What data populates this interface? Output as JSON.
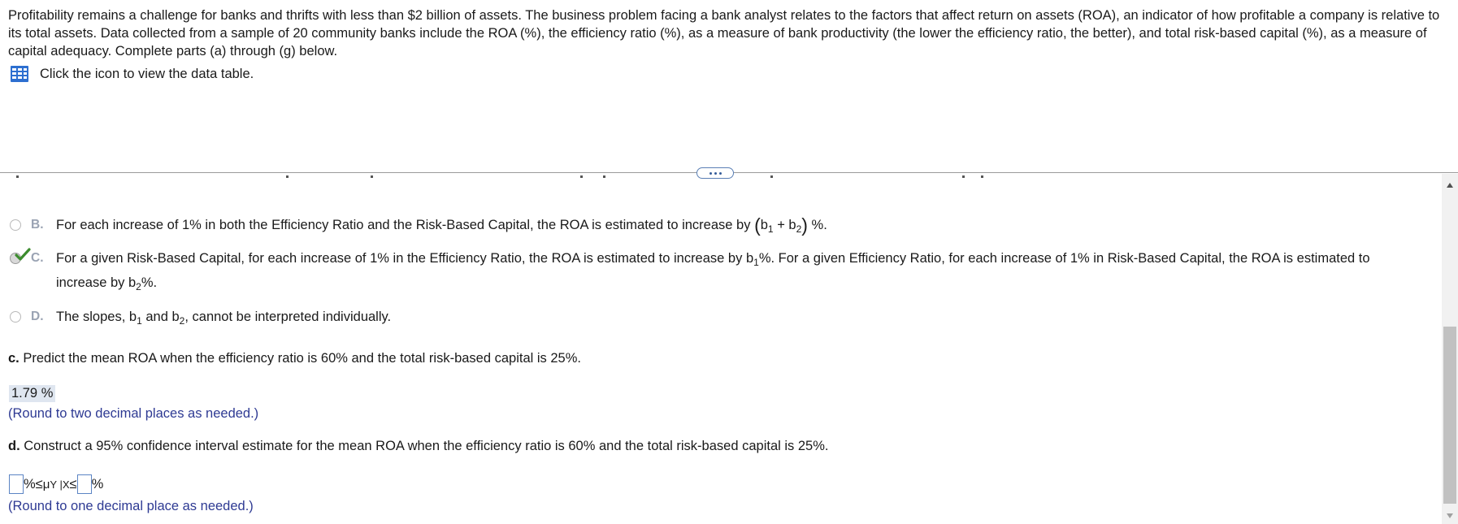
{
  "intro": {
    "paragraph": "Profitability remains a challenge for banks and thrifts with less than $2 billion of assets. The business problem facing a bank analyst relates to the factors that affect return on assets (ROA), an indicator of how profitable a company is relative to its total assets. Data collected from a sample of 20 community banks include the ROA (%), the efficiency ratio (%), as a measure of bank productivity (the lower the efficiency ratio, the better), and total risk-based capital (%), as a measure of capital adequacy. Complete parts (a) through (g) below.",
    "data_table_link": "Click the icon to view the data table.",
    "data_table_icon": "table-grid-icon"
  },
  "divider": {
    "more_icon": "ellipsis-icon"
  },
  "options": {
    "b": {
      "letter": "B.",
      "text_before": "For each increase of 1% in both the Efficiency Ratio and the Risk-Based Capital, the ROA is estimated to increase by ",
      "formula_open": "(",
      "b1": "b",
      "b1_sub": "1",
      "plus": " + ",
      "b2": "b",
      "b2_sub": "2",
      "formula_close": ")",
      "text_after": " %.",
      "selected": false
    },
    "c": {
      "letter": "C.",
      "text_1": "For a given Risk-Based Capital, for each increase of 1% in the Efficiency Ratio, the ROA is estimated to increase by ",
      "b1": "b",
      "b1_sub": "1",
      "text_2": "%. For a given Efficiency Ratio, for each increase  of 1% in Risk-Based Capital, the ROA is estimated to increase by ",
      "b2": "b",
      "b2_sub": "2",
      "text_3": "%.",
      "selected": true
    },
    "d": {
      "letter": "D.",
      "text_1": "The slopes, ",
      "b1": "b",
      "b1_sub": "1",
      "text_2": " and ",
      "b2": "b",
      "b2_sub": "2",
      "text_3": ", cannot be interpreted individually.",
      "selected": false
    }
  },
  "part_c": {
    "label": "c.",
    "question": " Predict the mean ROA when the efficiency ratio is 60% and the total risk-based capital is 25%.",
    "answer_value": "1.79",
    "answer_unit": " %",
    "hint": "(Round to two decimal places as needed.)"
  },
  "part_d": {
    "label": "d.",
    "question": " Construct a 95% confidence interval estimate for the mean ROA when the efficiency ratio is 60% and the total risk-based capital is 25%.",
    "lower_value": "",
    "pct1": "%",
    "le1": " ≤ ",
    "mu": "μ",
    "mu_sub": "Y |X",
    "le2": " ≤ ",
    "upper_value": "",
    "pct2": "%",
    "hint": "(Round to one decimal place as needed.)"
  },
  "colors": {
    "link_blue": "#2e3a93",
    "check_green": "#3c8c2e",
    "answer_bg": "#dfe6f0",
    "input_border": "#5b84c4"
  },
  "scrollbar": {
    "up_icon": "scroll-up-arrow-icon",
    "down_icon": "scroll-down-arrow-icon"
  }
}
